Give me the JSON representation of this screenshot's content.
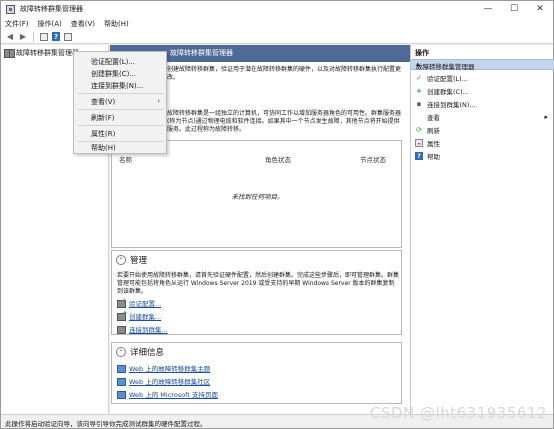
{
  "window": {
    "title": "故障转移群集管理器"
  },
  "menu": [
    "文件(F)",
    "操作(A)",
    "查看(V)",
    "帮助(H)"
  ],
  "tree": {
    "root": "故障转移群集管理器"
  },
  "context_menu": {
    "items": [
      "验证配置(L)...",
      "创建群集(C)...",
      "连接到群集(N)...",
      "查看(V)",
      "刷新(F)",
      "属性(R)",
      "帮助(H)"
    ]
  },
  "center": {
    "header": "故障转移群集管理器",
    "intro": "创建故障转移群集，验证用于潜在故障转移群集的硬件，以及对故障转移群集执行配置更改。",
    "desc": "故障转移群集是一组独立的计算机，可协同工作以增加服务器角色的可用性。群集服务器(称为节点)通过物理电缆和软件连接。如果其中一个节点发生故障，其他节点将开始提供服务。此过程称为故障转移。",
    "clusters_table": {
      "columns": [
        "名称",
        "角色状态",
        "节点状态"
      ],
      "empty": "未找到任何项目。"
    },
    "management": {
      "title": "管理",
      "text": "若要开始使用故障转移群集，请首先验证硬件配置，然后创建群集。完成这些步骤后，即可管理群集。群集管理可能包括将角色从运行 Windows Server 2019 或受支持的早期 Windows Server 版本的群集复制到该群集。",
      "links": [
        "验证配置...",
        "创建群集...",
        "连接到群集..."
      ]
    },
    "more_info": {
      "title": "详细信息",
      "links": [
        "Web 上的故障转移群集主题",
        "Web 上的故障转移群集社区",
        "Web 上的 Microsoft 支持页面"
      ]
    }
  },
  "actions": {
    "title": "操作",
    "group": "故障转移群集管理器",
    "items": [
      "验证配置(L)...",
      "创建群集(C)...",
      "连接到群集(N)...",
      "查看",
      "刷新",
      "属性",
      "帮助"
    ]
  },
  "status": "此操作将启动验证向导，该向导引导你完成测试群集的硬件配置过程。",
  "watermark": "CSDN @lht631935612",
  "colors": {
    "header_bg": "#4f6a97",
    "group_bg": "#c5d4ea",
    "link": "#1c4da0"
  }
}
